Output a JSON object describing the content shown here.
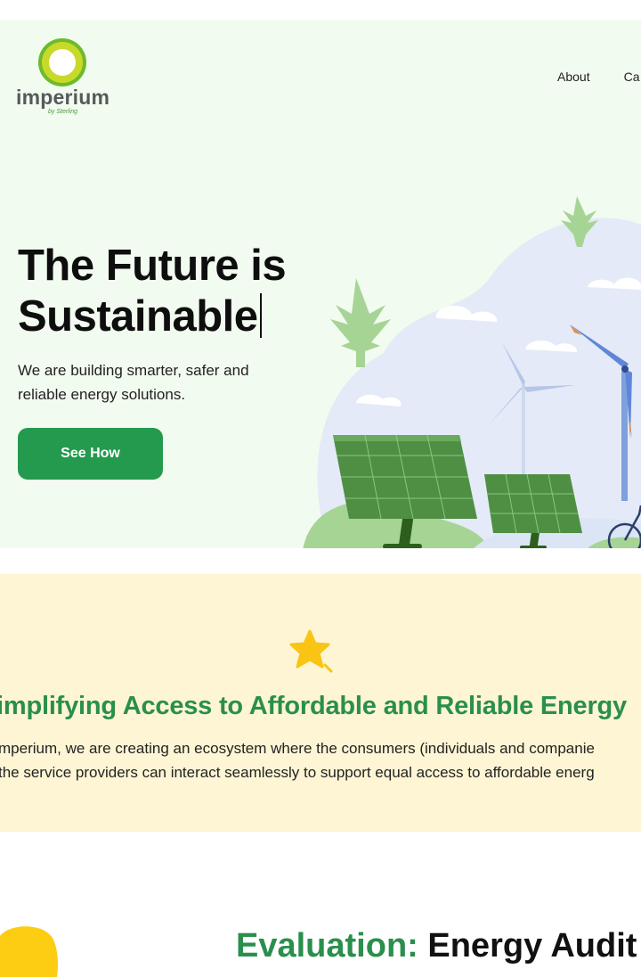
{
  "brand": {
    "name": "imperium",
    "tagline": "by Sterling"
  },
  "nav": {
    "items": [
      "About",
      "Ca"
    ]
  },
  "hero": {
    "title_line1": "The Future is",
    "title_line2": "Sustainable",
    "subtitle": "We are building smarter, safer and reliable energy solutions.",
    "cta_label": "See How"
  },
  "mission": {
    "title": "implifying Access to Affordable and Reliable Energy",
    "text_line1": "mperium, we are creating an ecosystem where the consumers (individuals and companie",
    "text_line2": "the service providers can interact seamlessly to support equal access to affordable energ"
  },
  "evaluation": {
    "label": "Evaluation:",
    "heading": "Energy Audit"
  },
  "colors": {
    "brand_green": "#249a4e",
    "heading_green": "#2a8f4c",
    "hero_bg": "#f2fbef",
    "band_bg": "#fdf5d4",
    "star": "#f9c414"
  },
  "icons": [
    "logo-ring-icon",
    "star-icon"
  ]
}
